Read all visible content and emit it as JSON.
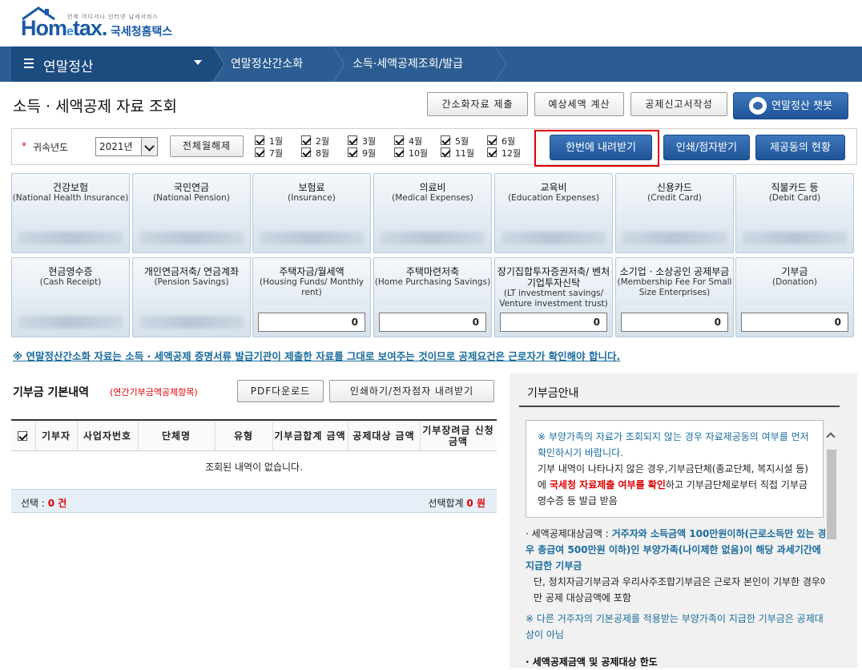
{
  "header": {
    "logo_tiny": "언제 어디서나 인터넷 납세서비스",
    "logo_brand_1": "Hom",
    "logo_brand_e": "e",
    "logo_brand_2": "tax.",
    "logo_kr": "국세청홈택스"
  },
  "nav": {
    "menu_label": "연말정산",
    "breadcrumb": [
      "연말정산간소화",
      "소득·세액공제조회/발급"
    ]
  },
  "page": {
    "title": "소득 · 세액공제 자료 조회"
  },
  "top_buttons": {
    "submit": "간소화자료 제출",
    "estimate": "예상세액 계산",
    "report": "공제신고서작성",
    "chatbot": "연말정산 챗봇"
  },
  "filter": {
    "required_mark": "*",
    "year_label": "귀속년도",
    "year_value": "2021년",
    "clear_all": "전체월해제",
    "months": [
      "1월",
      "2월",
      "3월",
      "4월",
      "5월",
      "6월",
      "7월",
      "8월",
      "9월",
      "10월",
      "11월",
      "12월"
    ],
    "download_all": "한번에 내려받기",
    "print": "인쇄/점자받기",
    "provider_status": "제공동의 현황"
  },
  "cards_row1": [
    {
      "k": "건강보험",
      "e": "(National Health Insurance)"
    },
    {
      "k": "국민연금",
      "e": "(National Pension)"
    },
    {
      "k": "보험료",
      "e": "(Insurance)"
    },
    {
      "k": "의료비",
      "e": "(Medical Expenses)"
    },
    {
      "k": "교육비",
      "e": "(Education Expenses)"
    },
    {
      "k": "신용카드",
      "e": "(Credit Card)"
    },
    {
      "k": "직불카드 등",
      "e": "(Debit Card)"
    }
  ],
  "cards_row2": [
    {
      "k": "현금영수증",
      "e": "(Cash Receipt)"
    },
    {
      "k": "개인연금저축/ 연금계좌",
      "e": "(Pension Savings)"
    },
    {
      "k": "주택자금/월세액",
      "e": "(Housing Funds/ Monthly rent)",
      "v": "0"
    },
    {
      "k": "주택마련저축",
      "e": "(Home Purchasing Savings)",
      "v": "0"
    },
    {
      "k": "장기집합투자증권저축/ 벤처기업투자신탁",
      "e": "(LT investment savings/ Venture investment trust)",
      "v": "0"
    },
    {
      "k": "소기업 · 소상공인 공제부금",
      "e": "(Membership Fee For Small Size Enterprises)",
      "v": "0"
    },
    {
      "k": "기부금",
      "e": "(Donation)",
      "v": "0"
    }
  ],
  "notice": "※ 연말정산간소화 자료는 소득 · 세액공제 증명서류 발급기관이 제출한 자료를 그대로 보여주는 것이므로 공제요건은 근로자가 확인해야 합니다.",
  "donation": {
    "title": "기부금 기본내역",
    "subtitle": "(연간기부금액공제항목)",
    "pdf_button": "PDF다운로드",
    "print_button": "인쇄하기/전자점자 내려받기",
    "columns": [
      "기부자",
      "사업자번호",
      "단체명",
      "유형",
      "기부금합계 금액",
      "공제대상 금액",
      "기부장려금 신청금액"
    ],
    "empty": "조회된 내역이 없습니다.",
    "selected_label": "선택 :",
    "selected_count": "0 건",
    "sum_label": "선택합계",
    "sum_value": "0 원"
  },
  "side": {
    "title": "기부금안내",
    "box_line1": "※ 부양가족의 자료가 조회되지 않는 경우 자료제공동의 여부를 먼저 확인하시기 바랍니다.",
    "box_line2a": "기부 내역이 나타나지 않은 경우,기부금단체(종교단체, 복지시설 등)에 ",
    "box_line2em": "국세청 자료제출 여부를 확인",
    "box_line2b": "하고 기부금단체로부터 직접 기부금영수증 등 발급 받음",
    "item1_prefix": "· 세액공제대상금액 : ",
    "item1_bold": "거주자와 소득금액 100만원이하(근로소득만 있는 경우 총급여 500만원 이하)인 부양가족(나이제한 없음)이 해당 과세기간에 지급한 기부금",
    "item1_tail": "단, 정치자금기부금과 우리사주조합기부금은 근로자 본인이 기부한 경우에만 공제 대상금액에 포함",
    "item1_note": "※ 다른 거주자의 기본공제를 적용받는 부양가족이 지급한 기부금은 공제대상이 아님",
    "item2": "· 세액공제금액 및 공제대상 한도"
  }
}
